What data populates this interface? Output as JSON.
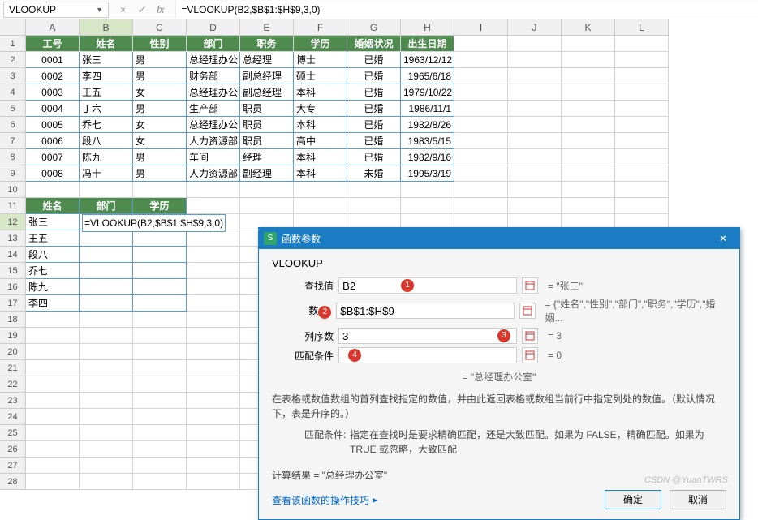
{
  "namebox": {
    "value": "VLOOKUP",
    "cancel_icon": "×",
    "accept_icon": "✓",
    "fx_icon": "fx"
  },
  "formula": "=VLOOKUP(B2,$B$1:$H$9,3,0)",
  "cols": [
    "A",
    "B",
    "C",
    "D",
    "E",
    "F",
    "G",
    "H",
    "I",
    "J",
    "K",
    "L"
  ],
  "rows": [
    "1",
    "2",
    "3",
    "4",
    "5",
    "6",
    "7",
    "8",
    "9",
    "10",
    "11",
    "12",
    "13",
    "14",
    "15",
    "16",
    "17",
    "18",
    "19",
    "20",
    "21",
    "22",
    "23",
    "24",
    "25",
    "26",
    "27",
    "28"
  ],
  "table_headers": [
    "工号",
    "姓名",
    "性别",
    "部门",
    "职务",
    "学历",
    "婚姻状况",
    "出生日期"
  ],
  "table_data": [
    [
      "0001",
      "张三",
      "男",
      "总经理办公",
      "总经理",
      "博士",
      "已婚",
      "1963/12/12"
    ],
    [
      "0002",
      "李四",
      "男",
      "财务部",
      "副总经理",
      "硕士",
      "已婚",
      "1965/6/18"
    ],
    [
      "0003",
      "王五",
      "女",
      "总经理办公",
      "副总经理",
      "本科",
      "已婚",
      "1979/10/22"
    ],
    [
      "0004",
      "丁六",
      "男",
      "生产部",
      "职员",
      "大专",
      "已婚",
      "1986/11/1"
    ],
    [
      "0005",
      "乔七",
      "女",
      "总经理办公",
      "职员",
      "本科",
      "已婚",
      "1982/8/26"
    ],
    [
      "0006",
      "段八",
      "女",
      "人力资源部",
      "职员",
      "高中",
      "已婚",
      "1983/5/15"
    ],
    [
      "0007",
      "陈九",
      "男",
      "车间",
      "经理",
      "本科",
      "已婚",
      "1982/9/16"
    ],
    [
      "0008",
      "冯十",
      "男",
      "人力资源部",
      "副经理",
      "本科",
      "未婚",
      "1995/3/19"
    ]
  ],
  "lookup_headers": [
    "姓名",
    "部门",
    "学历"
  ],
  "lookup_editing": "=VLOOKUP(B2,$B$1:$H$9,3,0)",
  "lookup_names": [
    "张三",
    "王五",
    "段八",
    "乔七",
    "陈九",
    "李四"
  ],
  "dialog": {
    "title": "函数参数",
    "func": "VLOOKUP",
    "params": {
      "p1": {
        "label": "查找值",
        "value": "B2",
        "result": "= \"张三\"",
        "badge": "1"
      },
      "p2": {
        "label": "数据",
        "value": "$B$1:$H$9",
        "result": "= {\"姓名\",\"性别\",\"部门\",\"职务\",\"学历\",\"婚姻...",
        "badge": "2"
      },
      "p3": {
        "label": "列序数",
        "value": "3",
        "result": "= 3",
        "badge": "3"
      },
      "p4": {
        "label": "匹配条件",
        "value": "0",
        "result": "= 0",
        "badge": "4"
      }
    },
    "interim_result": "= \"总经理办公室\"",
    "desc": "在表格或数值数组的首列查找指定的数值，并由此返回表格或数组当前行中指定列处的数值。（默认情况下，表是升序的。）",
    "sub_label": "匹配条件:",
    "sub_text": "指定在查找时是要求精确匹配，还是大致匹配。如果为 FALSE，精确匹配。如果为 TRUE 或忽略，大致匹配",
    "calc": "计算结果 = \"总经理办公室\"",
    "help": "查看该函数的操作技巧",
    "ok": "确定",
    "cancel": "取消"
  },
  "watermark": "CSDN @YuanTWRS"
}
